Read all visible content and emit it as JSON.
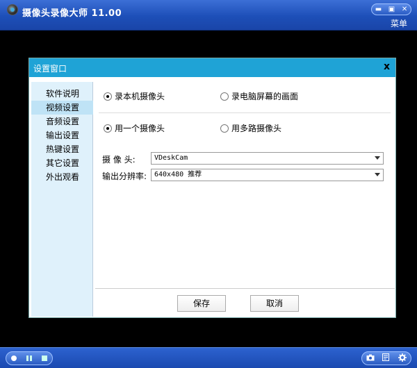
{
  "app": {
    "title": "摄像头录像大师 11.00",
    "menu_label": "菜单",
    "window_controls": [
      "▬",
      "▣",
      "✕"
    ]
  },
  "dialog": {
    "title": "设置窗口",
    "close": "x",
    "sidebar": [
      "软件说明",
      "视频设置",
      "音频设置",
      "输出设置",
      "热键设置",
      "其它设置",
      "外出观看"
    ],
    "active_index": 1,
    "source": {
      "option1": "录本机摄像头",
      "option2": "录电脑屏幕的画面",
      "selected": 1
    },
    "camera_mode": {
      "option1": "用一个摄像头",
      "option2": "用多路摄像头",
      "selected": 1
    },
    "camera_label": "摄  像  头:",
    "camera_value": "VDeskCam",
    "resolution_label": "输出分辨率:",
    "resolution_value": "640x480 推荐",
    "save_label": "保存",
    "cancel_label": "取消"
  },
  "bottom": {
    "left_icons": [
      "record-icon",
      "pause-icon",
      "stop-icon"
    ],
    "right_icons": [
      "camera-icon",
      "log-icon",
      "gear-icon"
    ]
  },
  "colors": {
    "titlebar": "#1d4fb8",
    "dialog_header": "#1fa3d6",
    "sidebar_bg": "#dff1fb",
    "sidebar_active": "#bfe3f6"
  }
}
